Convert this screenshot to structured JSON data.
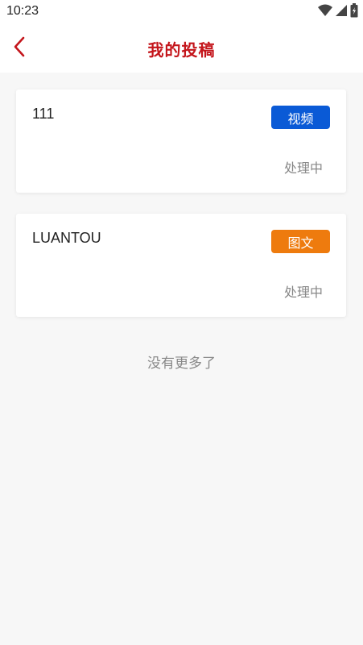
{
  "status_bar": {
    "time": "10:23",
    "icons": [
      "wifi-icon",
      "signal-icon",
      "battery-icon"
    ]
  },
  "header": {
    "back_icon": "chevron-left-icon",
    "title": "我的投稿",
    "accent_color": "#c4161c"
  },
  "submissions": [
    {
      "title": "111",
      "tag": "视频",
      "tag_color": "#0a5ad6",
      "status": "处理中"
    },
    {
      "title": "LUANTOU",
      "tag": "图文",
      "tag_color": "#ee7b0e",
      "status": "处理中"
    }
  ],
  "list_end_text": "没有更多了"
}
